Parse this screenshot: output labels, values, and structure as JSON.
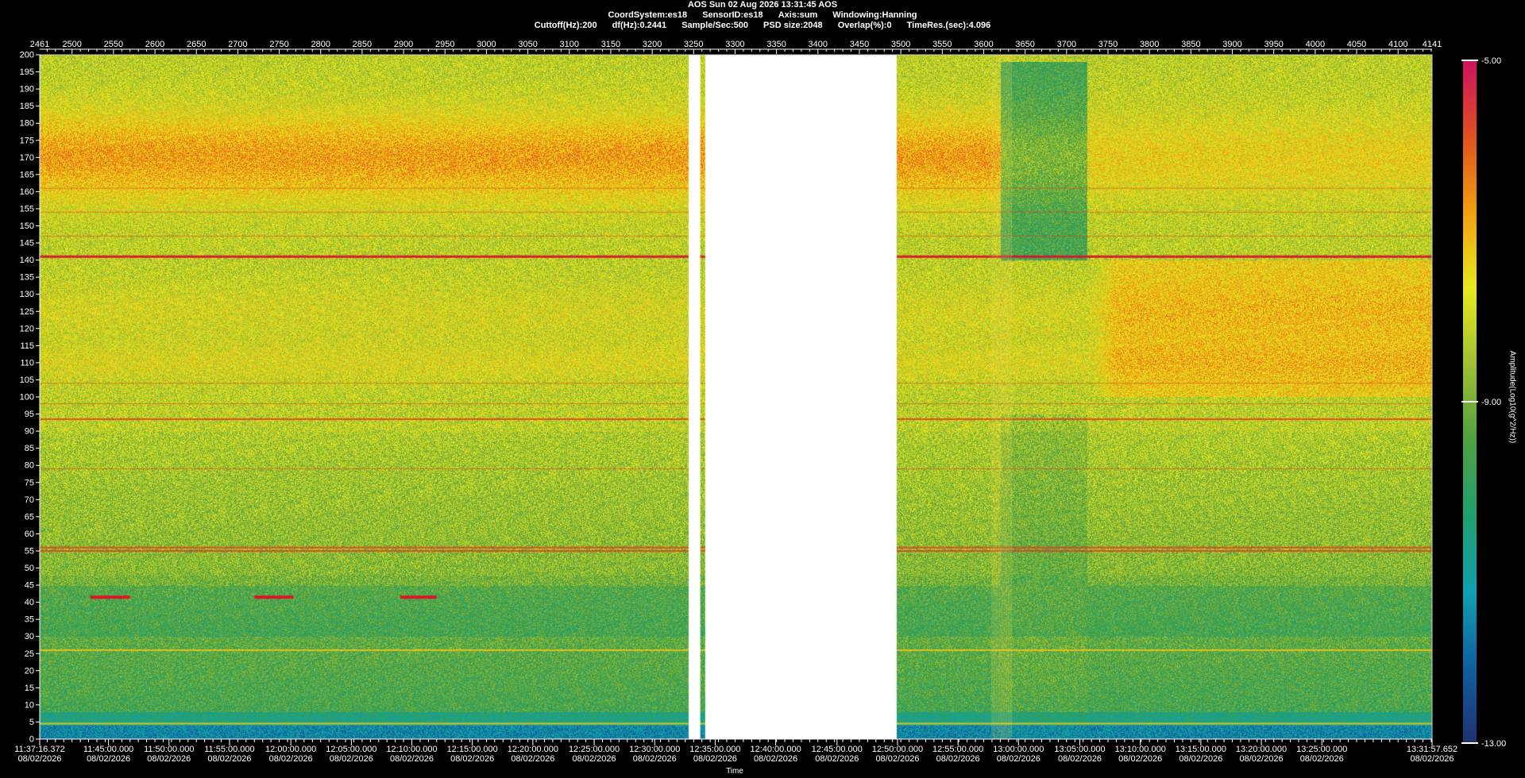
{
  "header": {
    "line1": "AOS  Sun 02 Aug 2026 13:31:45  AOS",
    "coord": "CoordSystem:es18",
    "sensor": "SensorID:es18",
    "axis": "Axis:sum",
    "window": "Windowing:Hanning",
    "cutoff": "Cuttoff(Hz):200",
    "df": "df(Hz):0.2441",
    "sample": "Sample/Sec:500",
    "psd": "PSD size:2048",
    "overlap": "Overlap(%):0",
    "timeres": "TimeRes.(sec):4.096"
  },
  "chart_data": {
    "type": "heatmap",
    "title": "AOS  Sun 02 Aug 2026 13:31:45  AOS",
    "xlabel": "Time",
    "ylabel": "",
    "colorbar_label": "Amplitude(Log10(g^2/Hz))",
    "ylim": [
      0,
      200
    ],
    "y_ticks": [
      0,
      5,
      10,
      15,
      20,
      25,
      30,
      35,
      40,
      45,
      50,
      55,
      60,
      65,
      70,
      75,
      80,
      85,
      90,
      95,
      100,
      105,
      110,
      115,
      120,
      125,
      130,
      135,
      140,
      145,
      150,
      155,
      160,
      165,
      170,
      175,
      180,
      185,
      190,
      195,
      200
    ],
    "top_axis": {
      "range": [
        2461,
        4141
      ],
      "ticks": [
        "2461",
        "2500",
        "2550",
        "2600",
        "2650",
        "2700",
        "2750",
        "2800",
        "2850",
        "2900",
        "2950",
        "3000",
        "3050",
        "3100",
        "3150",
        "3200",
        "3250",
        "3300",
        "3350",
        "3400",
        "3450",
        "3500",
        "3550",
        "3600",
        "3650",
        "3700",
        "3750",
        "3800",
        "3850",
        "3900",
        "3950",
        "4000",
        "4050",
        "4100",
        "4141"
      ]
    },
    "x_ticks": [
      {
        "frame": 2461,
        "time": "11:37:16.372",
        "date": "08/02/2026"
      },
      {
        "frame": 2544,
        "time": "11:45:00.000",
        "date": "08/02/2026"
      },
      {
        "frame": 2617,
        "time": "11:50:00.000",
        "date": "08/02/2026"
      },
      {
        "frame": 2690,
        "time": "11:55:00.000",
        "date": "08/02/2026"
      },
      {
        "frame": 2764,
        "time": "12:00:00.000",
        "date": "08/02/2026"
      },
      {
        "frame": 2837,
        "time": "12:05:00.000",
        "date": "08/02/2026"
      },
      {
        "frame": 2910,
        "time": "12:10:00.000",
        "date": "08/02/2026"
      },
      {
        "frame": 2983,
        "time": "12:15:00.000",
        "date": "08/02/2026"
      },
      {
        "frame": 3056,
        "time": "12:20:00.000",
        "date": "08/02/2026"
      },
      {
        "frame": 3130,
        "time": "12:25:00.000",
        "date": "08/02/2026"
      },
      {
        "frame": 3203,
        "time": "12:30:00.000",
        "date": "08/02/2026"
      },
      {
        "frame": 3276,
        "time": "12:35:00.000",
        "date": "08/02/2026"
      },
      {
        "frame": 3349,
        "time": "12:40:00.000",
        "date": "08/02/2026"
      },
      {
        "frame": 3423,
        "time": "12:45:00.000",
        "date": "08/02/2026"
      },
      {
        "frame": 3496,
        "time": "12:50:00.000",
        "date": "08/02/2026"
      },
      {
        "frame": 3569,
        "time": "12:55:00.000",
        "date": "08/02/2026"
      },
      {
        "frame": 3642,
        "time": "13:00:00.000",
        "date": "08/02/2026"
      },
      {
        "frame": 3716,
        "time": "13:05:00.000",
        "date": "08/02/2026"
      },
      {
        "frame": 3789,
        "time": "13:10:00.000",
        "date": "08/02/2026"
      },
      {
        "frame": 3862,
        "time": "13:15:00.000",
        "date": "08/02/2026"
      },
      {
        "frame": 3935,
        "time": "13:20:00.000",
        "date": "08/02/2026"
      },
      {
        "frame": 4008,
        "time": "13:25:00.000",
        "date": "08/02/2026"
      },
      {
        "frame": 4141,
        "time": "13:31:57.652",
        "date": "08/02/2026"
      }
    ],
    "colorbar": {
      "min": -13.0,
      "max": -5.0,
      "ticks": [
        {
          "value": -5.0,
          "label": "-5.00"
        },
        {
          "value": -9.0,
          "label": "-9.00"
        },
        {
          "value": -13.0,
          "label": "-13.00"
        }
      ],
      "stops": [
        "#203070",
        "#1060a0",
        "#10a0b0",
        "#20a070",
        "#50a040",
        "#a0c030",
        "#e8e820",
        "#f0a010",
        "#e05020",
        "#d01060"
      ]
    },
    "gaps": [
      [
        3244,
        3258
      ],
      [
        3264,
        3495
      ]
    ],
    "features": {
      "tone_lines_hz": [
        141,
        93.5,
        56,
        55,
        26,
        4.5
      ],
      "high_band_hz": [
        158,
        182
      ],
      "low_band_hz": [
        0,
        48
      ],
      "events_hz": 41.5,
      "event_frames": [
        2522,
        2570,
        2720,
        2767,
        2896,
        2940
      ]
    }
  }
}
